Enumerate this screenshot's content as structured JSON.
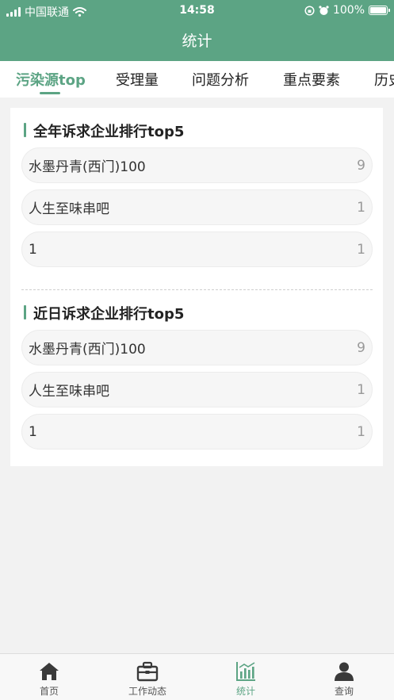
{
  "status_bar": {
    "carrier": "中国联通",
    "time": "14:58",
    "battery": "100%",
    "battery_level": 1.0
  },
  "header": {
    "title": "统计"
  },
  "tabs": [
    {
      "label": "污染源top",
      "active": true
    },
    {
      "label": "受理量"
    },
    {
      "label": "问题分析"
    },
    {
      "label": "重点要素"
    },
    {
      "label": "历史"
    }
  ],
  "sections": [
    {
      "title": "全年诉求企业排行top5",
      "rows": [
        {
          "name": "水墨丹青(西门)100",
          "count": "9"
        },
        {
          "name": "人生至味串吧",
          "count": "1"
        },
        {
          "name": "1",
          "count": "1"
        }
      ]
    },
    {
      "title": "近日诉求企业排行top5",
      "rows": [
        {
          "name": "水墨丹青(西门)100",
          "count": "9"
        },
        {
          "name": "人生至味串吧",
          "count": "1"
        },
        {
          "name": "1",
          "count": "1"
        }
      ]
    }
  ],
  "bottom_nav": [
    {
      "label": "首页",
      "icon": "home-icon"
    },
    {
      "label": "工作动态",
      "icon": "briefcase-icon"
    },
    {
      "label": "统计",
      "icon": "chart-icon",
      "active": true
    },
    {
      "label": "查询",
      "icon": "person-icon"
    }
  ],
  "colors": {
    "accent": "#5ca484",
    "background": "#f2f2f2"
  }
}
